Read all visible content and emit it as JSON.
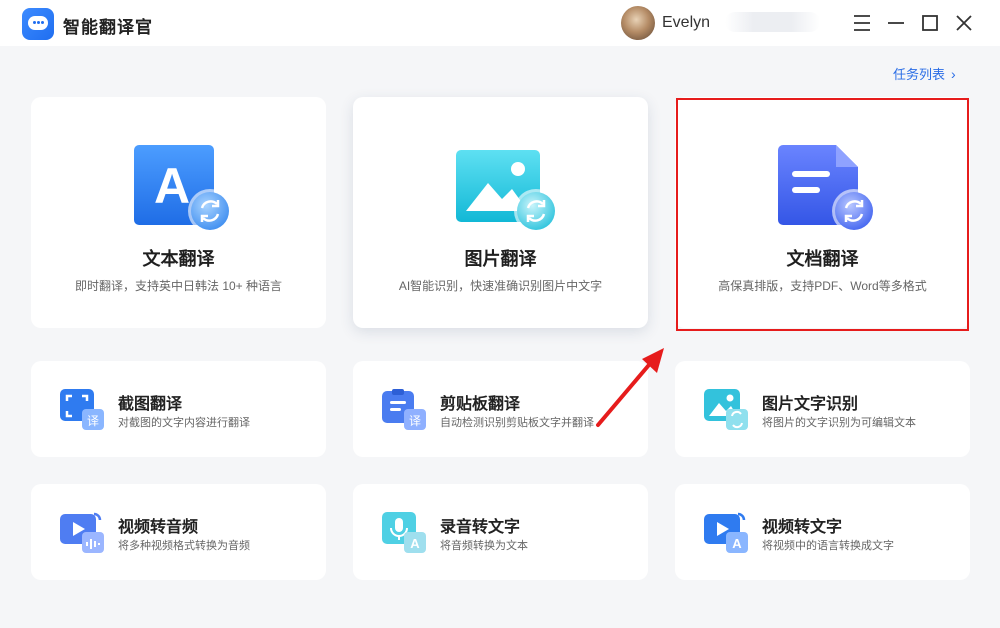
{
  "app": {
    "title": "智能翻译官"
  },
  "user": {
    "name": "Evelyn"
  },
  "window_controls": [
    "menu-icon",
    "minimize-icon",
    "maximize-icon",
    "close-icon"
  ],
  "header": {
    "task_list": "任务列表",
    "task_list_chevron": "›"
  },
  "featured": [
    {
      "id": "text",
      "title": "文本翻译",
      "desc": "即时翻译，支持英中日韩法 10+ 种语言",
      "icon_letter": "A"
    },
    {
      "id": "image",
      "title": "图片翻译",
      "desc": "AI智能识别，快速准确识别图片中文字"
    },
    {
      "id": "doc",
      "title": "文档翻译",
      "desc": "高保真排版，支持PDF、Word等多格式"
    }
  ],
  "tools": [
    {
      "id": "screenshot",
      "title": "截图翻译",
      "desc": "对截图的文字内容进行翻译",
      "badge": "译"
    },
    {
      "id": "clipboard",
      "title": "剪贴板翻译",
      "desc": "自动检测识别剪贴板文字并翻译",
      "badge": "译"
    },
    {
      "id": "ocr",
      "title": "图片文字识别",
      "desc": "将图片的文字识别为可编辑文本"
    },
    {
      "id": "video-audio",
      "title": "视频转音频",
      "desc": "将多种视频格式转换为音频"
    },
    {
      "id": "audio-text",
      "title": "录音转文字",
      "desc": "将音频转换为文本",
      "badge": "A"
    },
    {
      "id": "video-text",
      "title": "视频转文字",
      "desc": "将视频中的语言转换成文字",
      "badge": "A"
    }
  ],
  "colors": {
    "accent": "#2a6de6",
    "highlight": "#e61c1c",
    "background": "#f5f6f8"
  }
}
